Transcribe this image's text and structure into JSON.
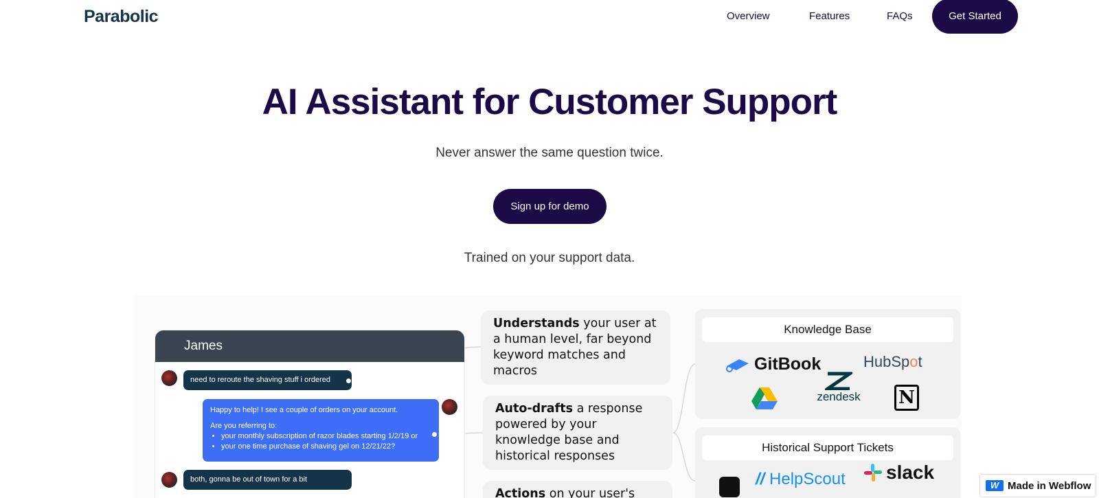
{
  "nav": {
    "logo": "Parabolic",
    "links": [
      "Overview",
      "Features",
      "FAQs"
    ],
    "cta": "Get Started"
  },
  "hero": {
    "title": "AI Assistant for Customer Support",
    "subtitle": "Never answer the same question twice.",
    "demo_button": "Sign up for demo",
    "trained": "Trained on your support data."
  },
  "chat": {
    "name": "James",
    "msg1": "need to reroute the shaving stuff i ordered",
    "msg2_line1": "Happy to help! I see a couple of orders on your account.",
    "msg2_line2": "Are you referring to:",
    "msg2_items": [
      "your monthly subscription of razor blades starting 1/2/19 or",
      "your one time purchase of shaving gel on 12/21/22?"
    ],
    "msg3": "both, gonna be out of town for a bit"
  },
  "features": [
    {
      "bold": "Understands",
      "rest": " your user at a human level, far beyond keyword matches and macros"
    },
    {
      "bold": "Auto-drafts",
      "rest": " a response powered by your knowledge base and historical responses"
    },
    {
      "bold": "Actions",
      "rest": " on your user's"
    }
  ],
  "panels": {
    "knowledge_base": "Knowledge Base",
    "kb_brands": {
      "gitbook": "GitBook",
      "hubspot_a": "HubSp",
      "hubspot_o": "o",
      "hubspot_b": "t",
      "zendesk": "zendesk",
      "notion": "N"
    },
    "historical": "Historical Support Tickets",
    "hist_brands": {
      "helpscout": "HelpScout",
      "slack": "slack"
    }
  },
  "badge": "Made in Webflow",
  "badge_icon": "W",
  "colors": {
    "brand_dark": "#1c0a46",
    "chat_blue": "#3d6ef5",
    "chat_dark": "#14344a"
  }
}
